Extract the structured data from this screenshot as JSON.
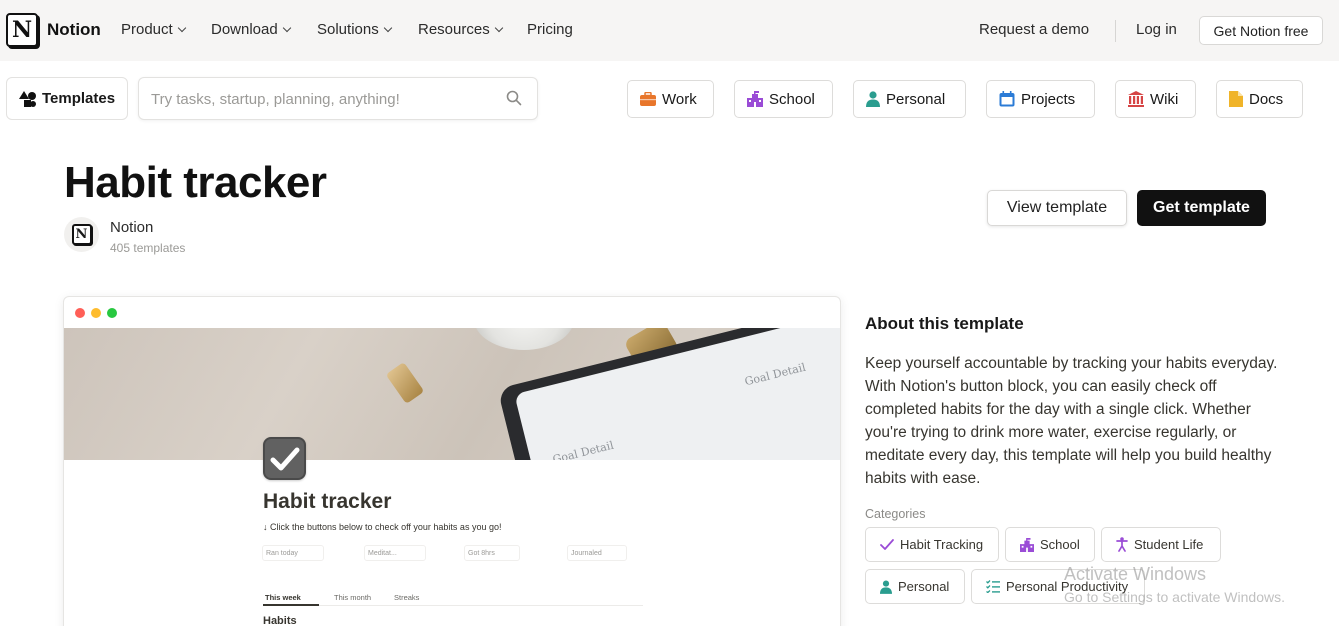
{
  "nav": {
    "brand": "Notion",
    "items": [
      {
        "label": "Product",
        "has_menu": true
      },
      {
        "label": "Download",
        "has_menu": true
      },
      {
        "label": "Solutions",
        "has_menu": true
      },
      {
        "label": "Resources",
        "has_menu": true
      },
      {
        "label": "Pricing",
        "has_menu": false
      }
    ],
    "request_demo": "Request a demo",
    "login": "Log in",
    "get_free": "Get Notion free"
  },
  "template_bar": {
    "templates_label": "Templates",
    "search_placeholder": "Try tasks, startup, planning, anything!",
    "categories": [
      {
        "label": "Work",
        "icon": "briefcase-icon",
        "color": "#e8762b"
      },
      {
        "label": "School",
        "icon": "school-icon",
        "color": "#9a4cd6"
      },
      {
        "label": "Personal",
        "icon": "person-icon",
        "color": "#2a9d8f"
      },
      {
        "label": "Projects",
        "icon": "calendar-icon",
        "color": "#2b7bd6"
      },
      {
        "label": "Wiki",
        "icon": "bank-icon",
        "color": "#d64545"
      },
      {
        "label": "Docs",
        "icon": "document-icon",
        "color": "#f0b429"
      }
    ]
  },
  "header": {
    "title": "Habit tracker",
    "author": "Notion",
    "author_count": "405 templates",
    "view_button": "View template",
    "get_button": "Get template"
  },
  "preview": {
    "page_title": "Habit tracker",
    "subtitle": "↓ Click the buttons below to check off your habits as you go!",
    "buttons": [
      "Ran today",
      "Meditat...",
      "Got 8hrs",
      "Journaled"
    ],
    "tabs": [
      "This week",
      "This month",
      "Streaks"
    ],
    "section": "Habits",
    "cover_text_1": "Goal Detail",
    "cover_text_2": "Goal Detail"
  },
  "about": {
    "heading": "About this template",
    "body": "Keep yourself accountable by tracking your habits everyday. With Notion's button block, you can easily check off completed habits for the day with a single click. Whether you're trying to drink more water, exercise regularly, or meditate every day, this template will help you build healthy habits with ease.",
    "categories_label": "Categories",
    "tags": [
      {
        "label": "Habit Tracking",
        "icon": "check-icon",
        "color": "#9a4cd6"
      },
      {
        "label": "School",
        "icon": "school-icon",
        "color": "#9a4cd6"
      },
      {
        "label": "Student Life",
        "icon": "figure-icon",
        "color": "#9a4cd6"
      },
      {
        "label": "Personal",
        "icon": "person-icon",
        "color": "#2a9d8f"
      },
      {
        "label": "Personal Productivity",
        "icon": "checklist-icon",
        "color": "#2a9d8f"
      }
    ]
  },
  "watermark": {
    "line1": "Activate Windows",
    "line2": "Go to Settings to activate Windows."
  }
}
